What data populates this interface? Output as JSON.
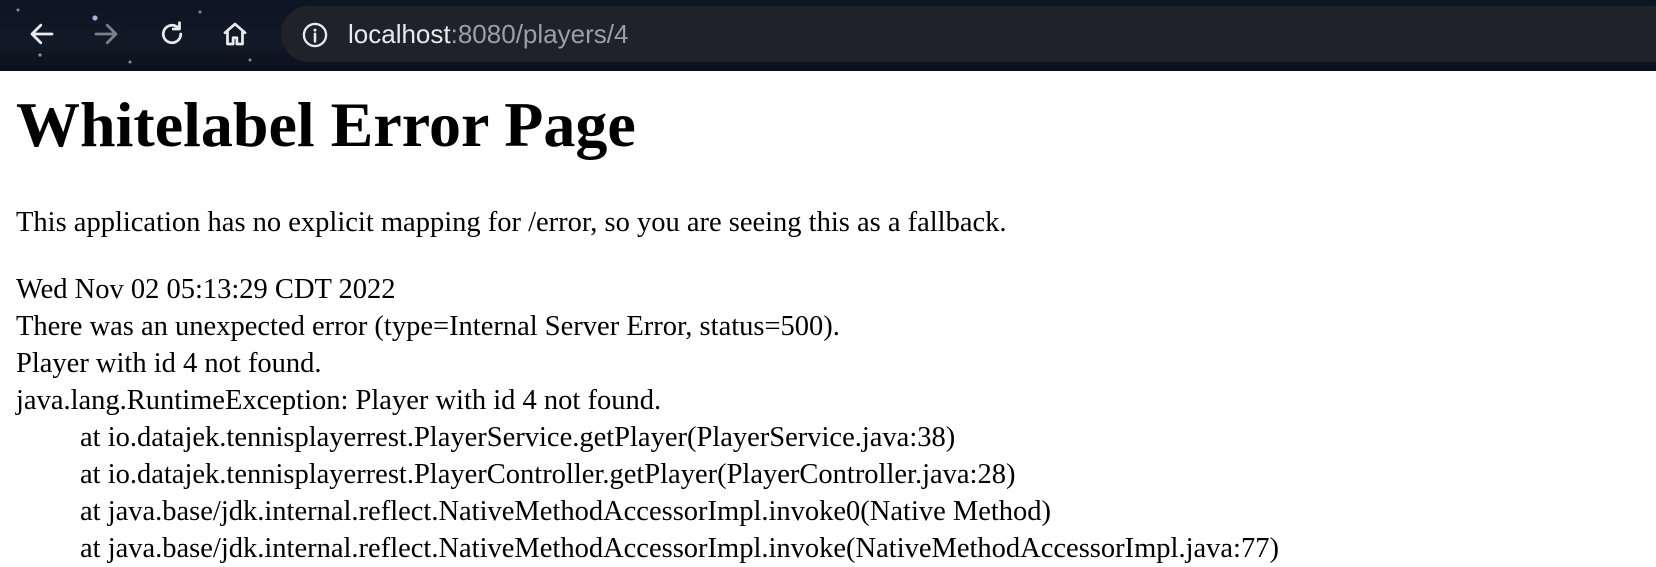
{
  "browser": {
    "url_host": "localhost",
    "url_rest": ":8080/players/4"
  },
  "page": {
    "title": "Whitelabel Error Page",
    "intro": "This application has no explicit mapping for /error, so you are seeing this as a fallback.",
    "timestamp": "Wed Nov 02 05:13:29 CDT 2022",
    "error_summary": "There was an unexpected error (type=Internal Server Error, status=500).",
    "message": "Player with id 4 not found.",
    "exception": "java.lang.RuntimeException: Player with id 4 not found.",
    "stack_trace": [
      "at io.datajek.tennisplayerrest.PlayerService.getPlayer(PlayerService.java:38)",
      "at io.datajek.tennisplayerrest.PlayerController.getPlayer(PlayerController.java:28)",
      "at java.base/jdk.internal.reflect.NativeMethodAccessorImpl.invoke0(Native Method)",
      "at java.base/jdk.internal.reflect.NativeMethodAccessorImpl.invoke(NativeMethodAccessorImpl.java:77)"
    ]
  }
}
